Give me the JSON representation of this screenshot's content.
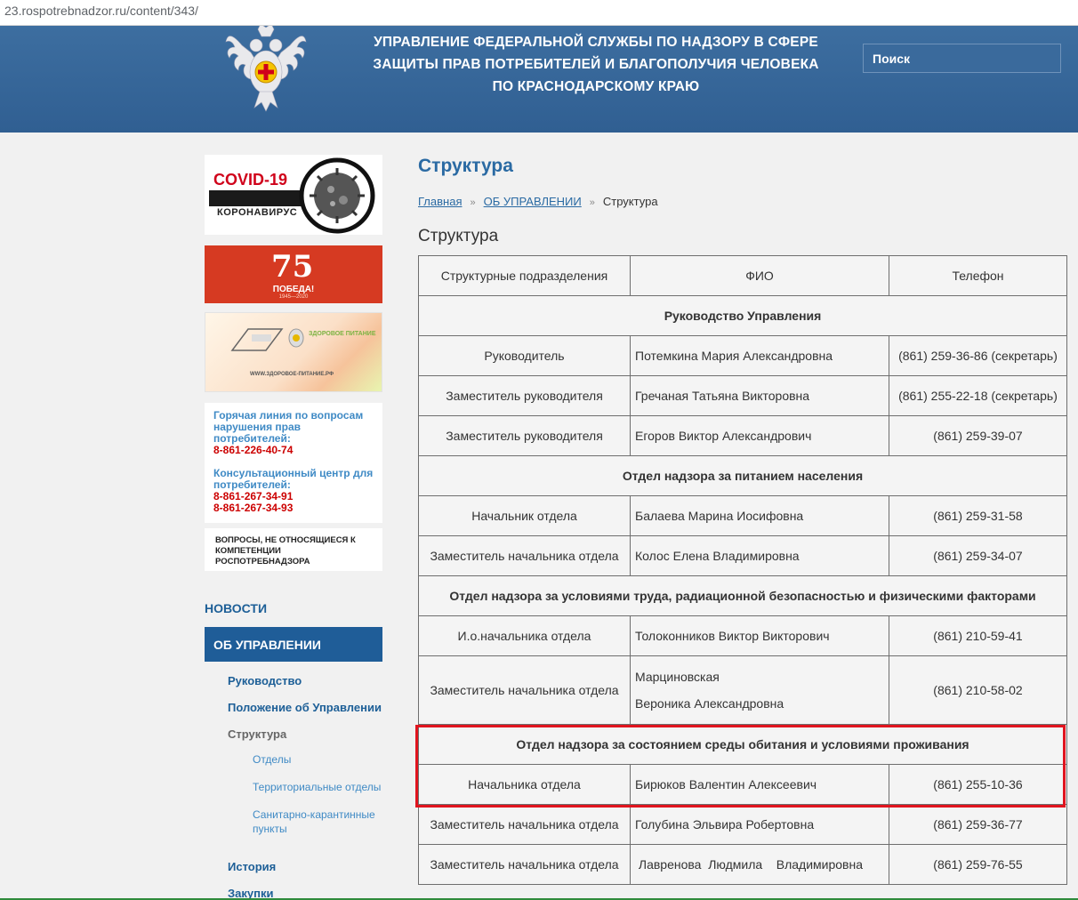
{
  "browser": {
    "url": "23.rospotrebnadzor.ru/content/343/"
  },
  "header": {
    "title_lines": [
      "УПРАВЛЕНИЕ ФЕДЕРАЛЬНОЙ СЛУЖБЫ ПО НАДЗОРУ В СФЕРЕ",
      "ЗАЩИТЫ ПРАВ ПОТРЕБИТЕЛЕЙ И БЛАГОПОЛУЧИЯ ЧЕЛОВЕКА",
      "ПО КРАСНОДАРСКОМУ КРАЮ"
    ],
    "search_placeholder": "Поиск",
    "emblem_icon": "coat-of-arms-emblem"
  },
  "sidebar": {
    "banners": {
      "covid_title": "COVID-19",
      "covid_subtitle": "КОРОНАВИРУС",
      "pobeda_number": "75",
      "pobeda_label": "ПОБЕДА!",
      "pobeda_years": "1945—2020",
      "food_label": "ЗДОРОВОЕ ПИТАНИЕ",
      "food_site": "WWW.ЗДОРОВОЕ-ПИТАНИЕ.РФ"
    },
    "hotline": {
      "title": "Горячая линия по вопросам нарушения прав потребителей:",
      "phone": "8-861-226-40-74",
      "consult_title": "Консультационный центр для потребителей:",
      "consult_phone1": "8-861-267-34-91",
      "consult_phone2": "8-861-267-34-93"
    },
    "other_questions": "ВОПРОСЫ, НЕ ОТНОСЯЩИЕСЯ К КОМПЕТЕНЦИИ РОСПОТРЕБНАДЗОРА",
    "nav": {
      "news": "НОВОСТИ",
      "about": "ОБ УПРАВЛЕНИИ",
      "items": [
        "Руководство",
        "Положение об Управлении",
        "Структура"
      ],
      "structure_sub": [
        "Отделы",
        "Территориальные отделы",
        "Санитарно-карантинные пункты"
      ],
      "more": [
        "История",
        "Закупки"
      ]
    }
  },
  "main": {
    "page_title": "Структура",
    "breadcrumb": {
      "home": "Главная",
      "section": "ОБ УПРАВЛЕНИИ",
      "current": "Структура",
      "sep": "»"
    },
    "content_title": "Структура",
    "table": {
      "headers": [
        "Структурные подразделения",
        "ФИО",
        "Телефон"
      ],
      "sections": [
        {
          "title": "Руководство Управления",
          "rows": [
            [
              "Руководитель",
              "Потемкина Мария Александровна",
              "(861) 259-36-86 (секретарь)"
            ],
            [
              "Заместитель руководителя",
              "Гречаная Татьяна Викторовна",
              "(861) 255-22-18 (секретарь)"
            ],
            [
              "Заместитель руководителя",
              "Егоров Виктор Александрович",
              "(861) 259-39-07"
            ]
          ]
        },
        {
          "title": "Отдел надзора за питанием населения",
          "rows": [
            [
              "Начальник отдела",
              "Балаева Марина Иосифовна",
              "(861) 259-31-58"
            ],
            [
              "Заместитель начальника отдела",
              "Колос Елена Владимировна",
              "(861) 259-34-07"
            ]
          ]
        },
        {
          "title": "Отдел надзора за условиями труда, радиационной безопасностью и физическими факторами",
          "rows": [
            [
              "И.о.начальника отдела",
              "Толоконников Виктор Викторович",
              "(861) 210-59-41"
            ],
            [
              "Заместитель начальника отдела",
              "Марциновская|Вероника Александровна",
              "(861) 210-58-02"
            ]
          ]
        },
        {
          "title": "Отдел надзора за состоянием среды обитания и условиями проживания",
          "rows": [
            [
              "Начальника отдела",
              "Бирюков Валентин Алексеевич",
              "(861) 255-10-36"
            ],
            [
              "Заместитель начальника отдела",
              "Голубина Эльвира Робертовна",
              "(861) 259-36-77"
            ],
            [
              "Заместитель начальника отдела",
              " Лавренова  Людмила    Владимировна",
              "(861) 259-76-55"
            ]
          ]
        }
      ]
    }
  },
  "colors": {
    "header_bg": "#336699",
    "link": "#2a6aa3",
    "highlight": "#e0141e"
  }
}
